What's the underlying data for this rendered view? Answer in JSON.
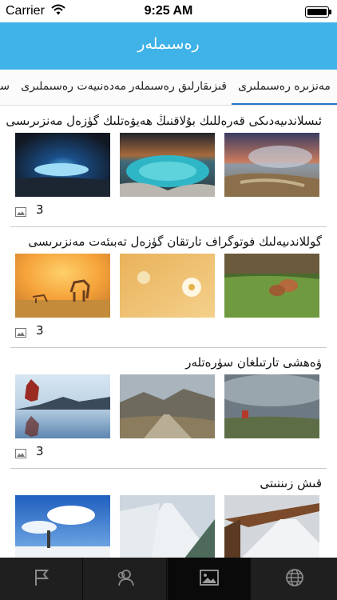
{
  "status_bar": {
    "carrier": "Carrier",
    "time": "9:25 AM"
  },
  "header": {
    "title": "رەسىملەر"
  },
  "tabs": [
    {
      "label": "مەنزىرە رەسىملىرى",
      "active": true
    },
    {
      "label": "قىزىقارلىق رەسىملەر",
      "active": false
    },
    {
      "label": "مەدەنىيەت رەسىملىرى",
      "active": false
    },
    {
      "label": "سەنئەت",
      "active": false
    }
  ],
  "albums": [
    {
      "title": "ئىسلاندىيەدىكى قەرەللىك بۇلاقنىڭ ھەيۋەتلىك گۈزەل مەنزىرىسى",
      "count": "3"
    },
    {
      "title": "گوللاندىيەلىك فوتوگراف تارتقان گۈزەل تەبىئەت مەنزىرىسى",
      "count": "3"
    },
    {
      "title": "ۋەھشى تارتىلغان سۈرەتلەر",
      "count": "3"
    },
    {
      "title": "قىش زىننىتى",
      "count": ""
    }
  ],
  "bottom_tabs": [
    {
      "icon": "flag-icon",
      "active": false
    },
    {
      "icon": "people-icon",
      "active": false
    },
    {
      "icon": "photo-icon",
      "active": true
    },
    {
      "icon": "globe-icon",
      "active": false
    }
  ],
  "colors": {
    "header": "#3fb2e8",
    "tab_indicator": "#2a74c9",
    "tabbar": "#1f1f1f"
  }
}
